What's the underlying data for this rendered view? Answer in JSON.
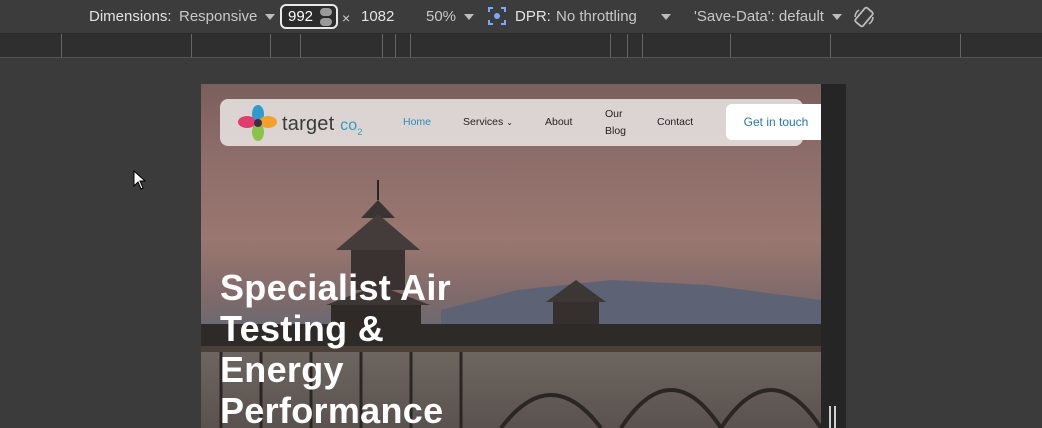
{
  "toolbar": {
    "dimensions_label": "Dimensions:",
    "device_select": "Responsive",
    "width_value": "992",
    "times_sign": "×",
    "height_value": "1082",
    "zoom": "50%",
    "dpr_label": "DPR:",
    "throttling": "No throttling",
    "save_data": "'Save-Data': default"
  },
  "site": {
    "brand": "target",
    "brand_suffix": "co",
    "brand_sub": "2",
    "nav": [
      {
        "label": "Home",
        "active": true
      },
      {
        "label": "Services",
        "active": false
      },
      {
        "label": "About",
        "active": false
      },
      {
        "label": "Our",
        "active": false
      },
      {
        "label": "Blog",
        "active": false
      },
      {
        "label": "Contact",
        "active": false
      }
    ],
    "cta_label": "Get in touch",
    "hero_title_lines": [
      "Specialist Air",
      "Testing &",
      "Energy",
      "Performance"
    ]
  },
  "colors": {
    "toolbar_bg": "#3c3c3c",
    "accent_nav": "#2b8fb8",
    "cta_text": "#2577b3"
  },
  "icons": [
    "dpr-icon",
    "rotate-icon",
    "chevron-down-icon",
    "cursor-icon",
    "logo-icon"
  ]
}
